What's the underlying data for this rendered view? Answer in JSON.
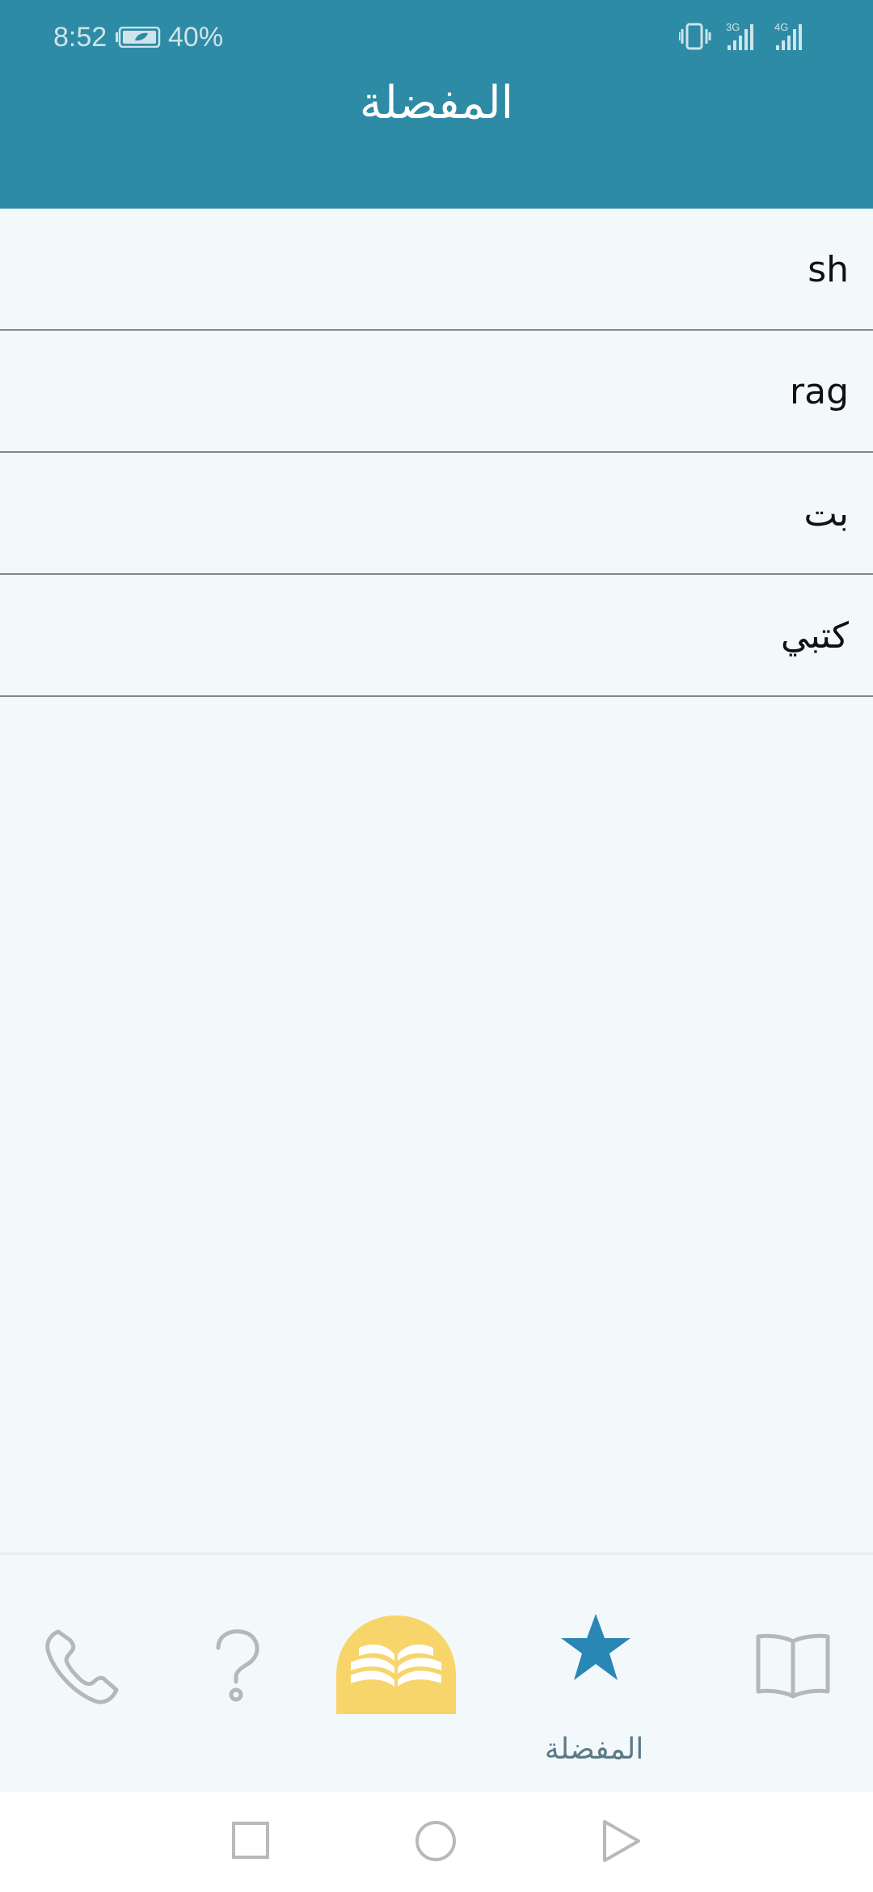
{
  "status_bar": {
    "time": "8:52",
    "battery_percent": "40%",
    "network_labels": [
      "3G",
      "4G"
    ]
  },
  "header": {
    "title": "المفضلة"
  },
  "favorites": [
    {
      "text": "sh"
    },
    {
      "text": "rag"
    },
    {
      "text": "بت"
    },
    {
      "text": "كتبي"
    }
  ],
  "bottom_nav": {
    "items": [
      {
        "icon": "phone-icon"
      },
      {
        "icon": "question-icon"
      },
      {
        "icon": "open-book-logo-icon"
      },
      {
        "icon": "star-icon",
        "label": "المفضلة",
        "active": true
      },
      {
        "icon": "book-icon"
      }
    ]
  },
  "colors": {
    "accent": "#2e8ba5",
    "active_icon": "#2a86b4",
    "inactive_icon": "#b5b8ba",
    "logo_bg": "#f8d56a"
  }
}
